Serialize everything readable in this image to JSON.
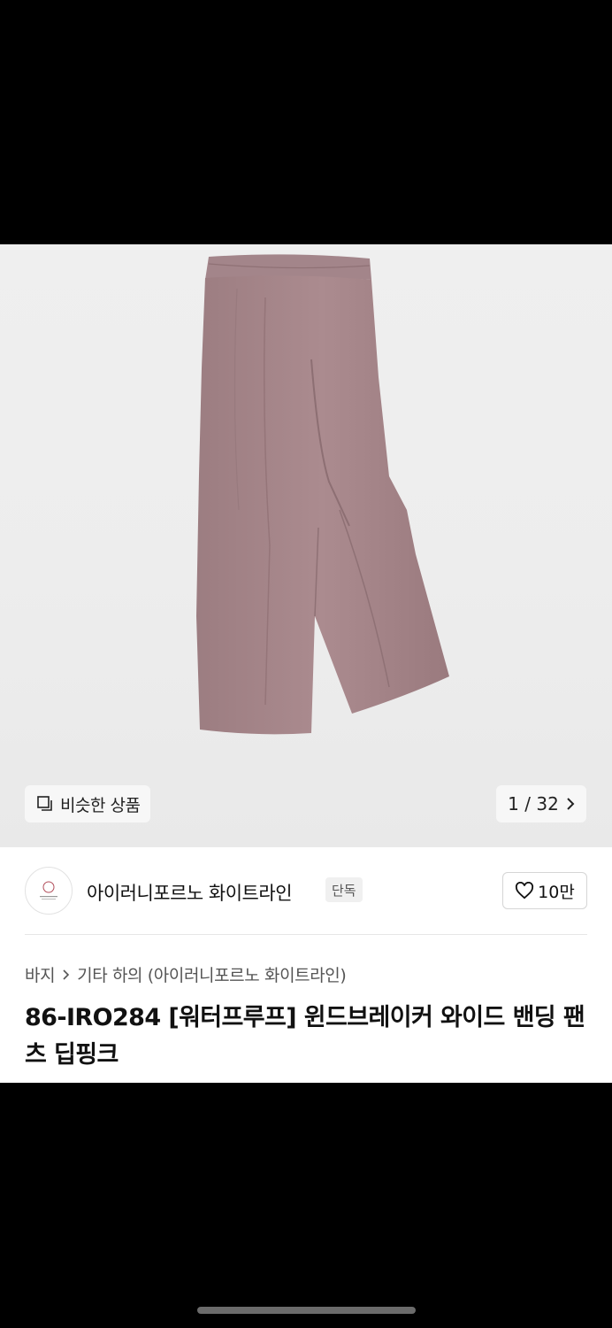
{
  "gallery": {
    "similar_label": "비슷한 상품",
    "counter": "1 / 32"
  },
  "brand": {
    "name": "아이러니포르노 화이트라인",
    "badge": "단독",
    "likes": "10만"
  },
  "breadcrumb": {
    "category": "바지",
    "subcategory": "기타 하의 (아이러니포르노 화이트라인)"
  },
  "product": {
    "title": "86-IRO284 [워터프루프] 윈드브레이커 와이드 밴딩 팬츠 딥핑크"
  },
  "colors": {
    "garment": "#a6868a",
    "background": "#000000"
  }
}
